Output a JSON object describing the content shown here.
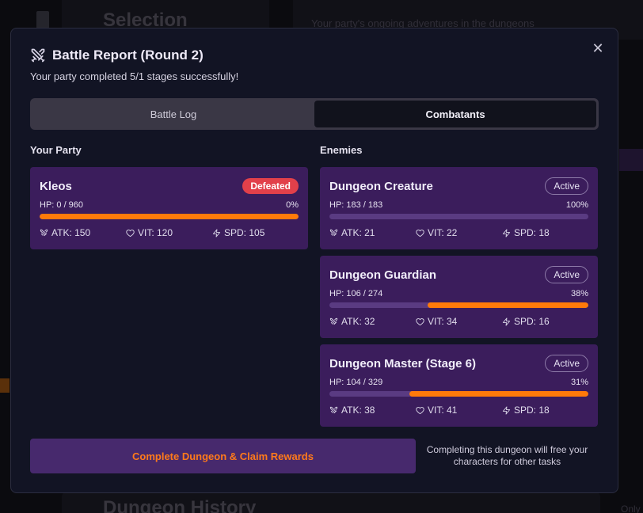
{
  "background": {
    "selection_title": "Selection",
    "subtitle": "Your party's ongoing adventures in the dungeons",
    "history_title": "Dungeon History",
    "side_text": "Only"
  },
  "modal": {
    "title": "Battle Report (Round 2)",
    "subtitle": "Your party completed 5/1 stages successfully!",
    "close_icon": "close-icon",
    "title_icon": "crossed-swords-icon",
    "tabs": [
      {
        "label": "Battle Log",
        "active": false
      },
      {
        "label": "Combatants",
        "active": true
      }
    ],
    "party_heading": "Your Party",
    "enemies_heading": "Enemies",
    "party": [
      {
        "name": "Kleos",
        "status": "Defeated",
        "hp": "HP: 0 / 960",
        "pct": "0%",
        "fill": 1.0,
        "atk": "ATK: 150",
        "vit": "VIT: 120",
        "spd": "SPD: 105"
      }
    ],
    "enemies": [
      {
        "name": "Dungeon Creature",
        "status": "Active",
        "hp": "HP: 183 / 183",
        "pct": "100%",
        "fill": 0.0,
        "atk": "ATK: 21",
        "vit": "VIT: 22",
        "spd": "SPD: 18"
      },
      {
        "name": "Dungeon Guardian",
        "status": "Active",
        "hp": "HP: 106 / 274",
        "pct": "38%",
        "fill": 0.62,
        "atk": "ATK: 32",
        "vit": "VIT: 34",
        "spd": "SPD: 16"
      },
      {
        "name": "Dungeon Master (Stage 6)",
        "status": "Active",
        "hp": "HP: 104 / 329",
        "pct": "31%",
        "fill": 0.69,
        "atk": "ATK: 38",
        "vit": "VIT: 41",
        "spd": "SPD: 18"
      }
    ],
    "claim_label": "Complete Dungeon & Claim Rewards",
    "footer_note": "Completing this dungeon will free your characters for other tasks"
  },
  "colors": {
    "accent_orange": "#ff7a0a",
    "card_purple": "#3b1d5c",
    "defeated_red": "#e2404a"
  }
}
